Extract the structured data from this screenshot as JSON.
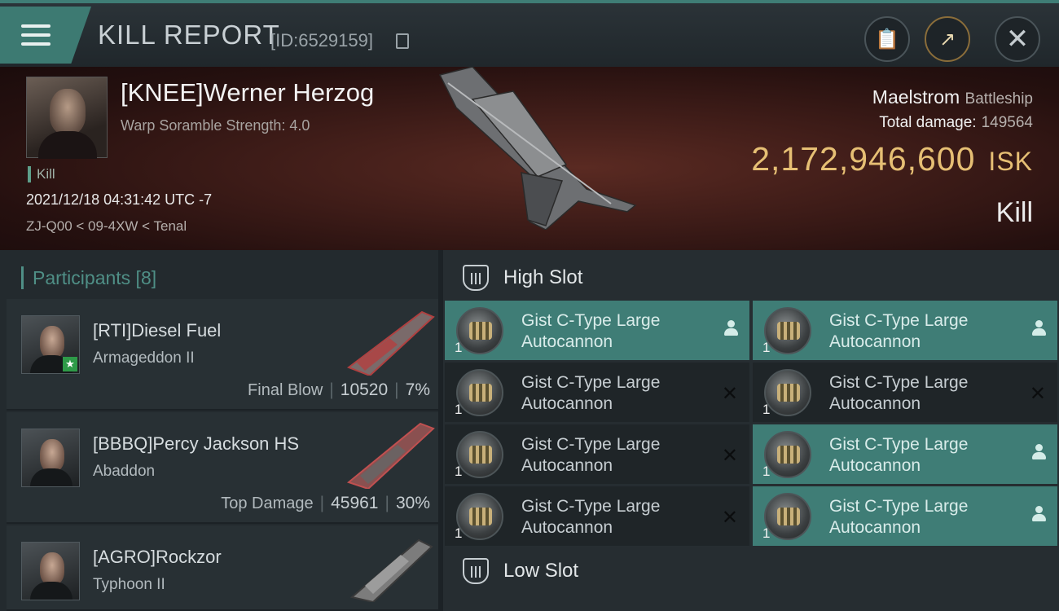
{
  "header": {
    "title": "KILL REPORT",
    "id_text": "[ID:6529159]",
    "menu_icon": "hamburger-icon",
    "buttons": [
      {
        "name": "clipboard",
        "icon": "clipboard-icon"
      },
      {
        "name": "share",
        "icon": "share-icon"
      },
      {
        "name": "close",
        "icon": "close-icon"
      }
    ]
  },
  "victim": {
    "name": "[KNEE]Werner Herzog",
    "subtitle": "Warp Soramble Strength: 4.0",
    "tag": "Kill",
    "datetime": "2021/12/18 04:31:42 UTC -7",
    "location": "ZJ-Q00 < 09-4XW < Tenal",
    "ship_name": "Maelstrom",
    "ship_class": "Battleship",
    "total_damage_label": "Total damage:",
    "total_damage": "149564",
    "isk_value": "2,172,946,600",
    "isk_unit": "ISK",
    "result_label": "Kill"
  },
  "participants": {
    "header": "Participants [8]",
    "items": [
      {
        "name": "[RTI]Diesel Fuel",
        "ship": "Armageddon II",
        "role": "Final Blow",
        "damage": "10520",
        "percent": "7%"
      },
      {
        "name": "[BBBQ]Percy Jackson HS",
        "ship": "Abaddon",
        "role": "Top Damage",
        "damage": "45961",
        "percent": "30%"
      },
      {
        "name": "[AGRO]Rockzor",
        "ship": "Typhoon II"
      }
    ]
  },
  "fitting": {
    "high_slot_label": "High Slot",
    "low_slot_label": "Low Slot",
    "modules": [
      {
        "name": "Gist C-Type Large Autocannon",
        "qty": "1",
        "state": "dropped",
        "state_icon": "person-icon"
      },
      {
        "name": "Gist C-Type Large Autocannon",
        "qty": "1",
        "state": "dropped",
        "state_icon": "person-icon"
      },
      {
        "name": "Gist C-Type Large Autocannon",
        "qty": "1",
        "state": "destroyed",
        "state_icon": "x-icon"
      },
      {
        "name": "Gist C-Type Large Autocannon",
        "qty": "1",
        "state": "destroyed",
        "state_icon": "x-icon"
      },
      {
        "name": "Gist C-Type Large Autocannon",
        "qty": "1",
        "state": "destroyed",
        "state_icon": "x-icon"
      },
      {
        "name": "Gist C-Type Large Autocannon",
        "qty": "1",
        "state": "dropped",
        "state_icon": "person-icon"
      },
      {
        "name": "Gist C-Type Large Autocannon",
        "qty": "1",
        "state": "destroyed",
        "state_icon": "x-icon"
      },
      {
        "name": "Gist C-Type Large Autocannon",
        "qty": "1",
        "state": "dropped",
        "state_icon": "person-icon"
      }
    ]
  },
  "colors": {
    "accent": "#3f7d76",
    "isk_gold": "#e6bf74",
    "banner_red": "#5a2a22"
  }
}
